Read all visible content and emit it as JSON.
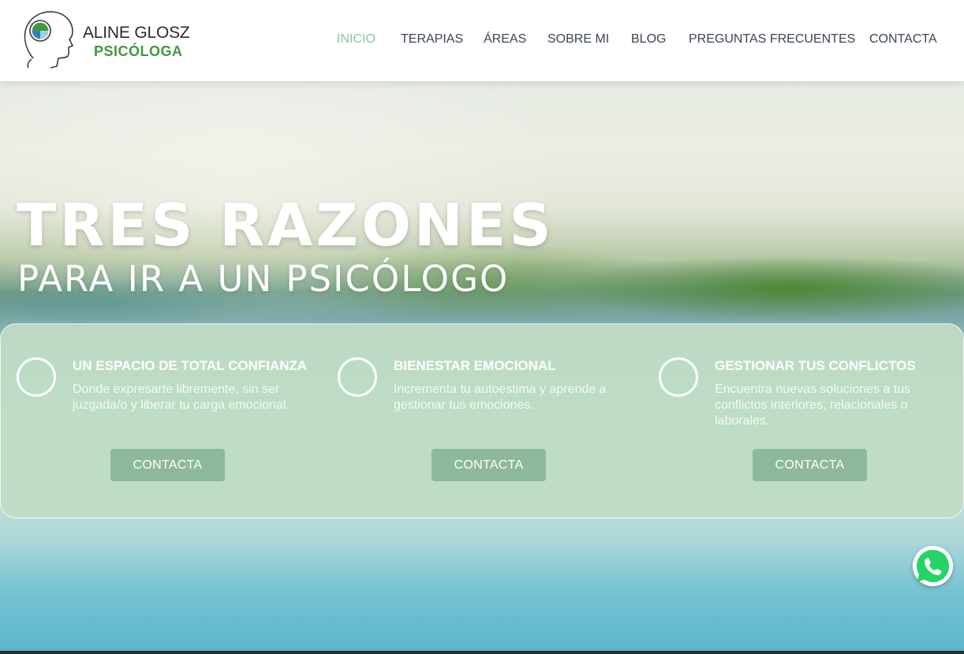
{
  "brand": {
    "name": "ALINE GLOSZ",
    "subtitle": "PSICÓLOGA",
    "logo_icon": "head-profile-logo-icon"
  },
  "nav": {
    "items": [
      {
        "label": "INICIO",
        "active": true
      },
      {
        "label": "TERAPIAS",
        "active": false
      },
      {
        "label": "ÁREAS",
        "active": false
      },
      {
        "label": "SOBRE MI",
        "active": false
      },
      {
        "label": "BLOG",
        "active": false
      },
      {
        "label": "PREGUNTAS FRECUENTES",
        "active": false
      },
      {
        "label": "CONTACTA",
        "active": false
      }
    ]
  },
  "hero": {
    "title": "TRES RAZONES",
    "subtitle": "PARA IR A UN PSICÓLOGO"
  },
  "reasons": [
    {
      "icon": "circle-icon",
      "title": "UN ESPACIO DE TOTAL CONFIANZA",
      "text": "Donde expresarte libremente, sin ser juzgada/o y liberar tu carga emocional.",
      "button": "CONTACTA"
    },
    {
      "icon": "circle-icon",
      "title": "BIENESTAR EMOCIONAL",
      "text": "Incrementa tu autoestima y aprende a gestionar tus emociones.",
      "button": "CONTACTA"
    },
    {
      "icon": "circle-icon",
      "title": "GESTIONAR TUS CONFLICTOS",
      "text": "Encuentra nuevas soluciones a tus conflictos interiores, relacionales o laborales.",
      "button": "CONTACTA"
    }
  ],
  "whatsapp": {
    "icon": "whatsapp-icon"
  },
  "colors": {
    "accent_green": "#3e9a3a",
    "nav_active": "#8fc49a",
    "nav_text": "#3a4552",
    "panel_bg": "#bedcc4",
    "button_bg": "#8db89b",
    "whatsapp_green": "#25d366"
  }
}
